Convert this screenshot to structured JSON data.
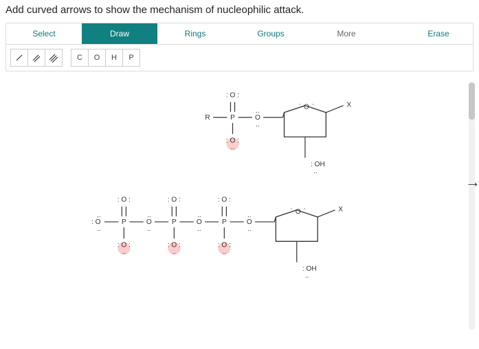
{
  "question": "Add curved arrows to show the mechanism of nucleophilic attack.",
  "tabs": {
    "select": "Select",
    "draw": "Draw",
    "rings": "Rings",
    "groups": "Groups",
    "more": "More",
    "erase": "Erase"
  },
  "atom_buttons": {
    "c": "C",
    "o": "O",
    "h": "H",
    "p": "P"
  },
  "labels": {
    "R": "R",
    "P": "P",
    "O": "O",
    "X": "X",
    "OH": "OH",
    "O_lp": ": O :",
    "O_lp_side": "O",
    "O_neg": "O",
    "O_lp_top": ": O :",
    "colon": ":",
    "dcolon": ".."
  },
  "chart_data": {
    "type": "diagram",
    "description": "Two chemical structure fragments shown in a drawing editor. Top: R–P(=O)(:O:)–O– attached via oxygen bridge to a five‑membered ring bearing an X substituent and an :OH substituent. Bottom: a linear chain :O–P(=O)(:O:)–O–P(=O)(:O:)–O–P(=O)(:O:)–O– attached via oxygen bridge to a second five‑membered ring, also with X and :OH substituents. Several oxygens carry lone‑pair notation (: O :) and three lower oxygens are highlighted (negative/partial‑charge hint).",
    "active_tool": "Draw"
  }
}
